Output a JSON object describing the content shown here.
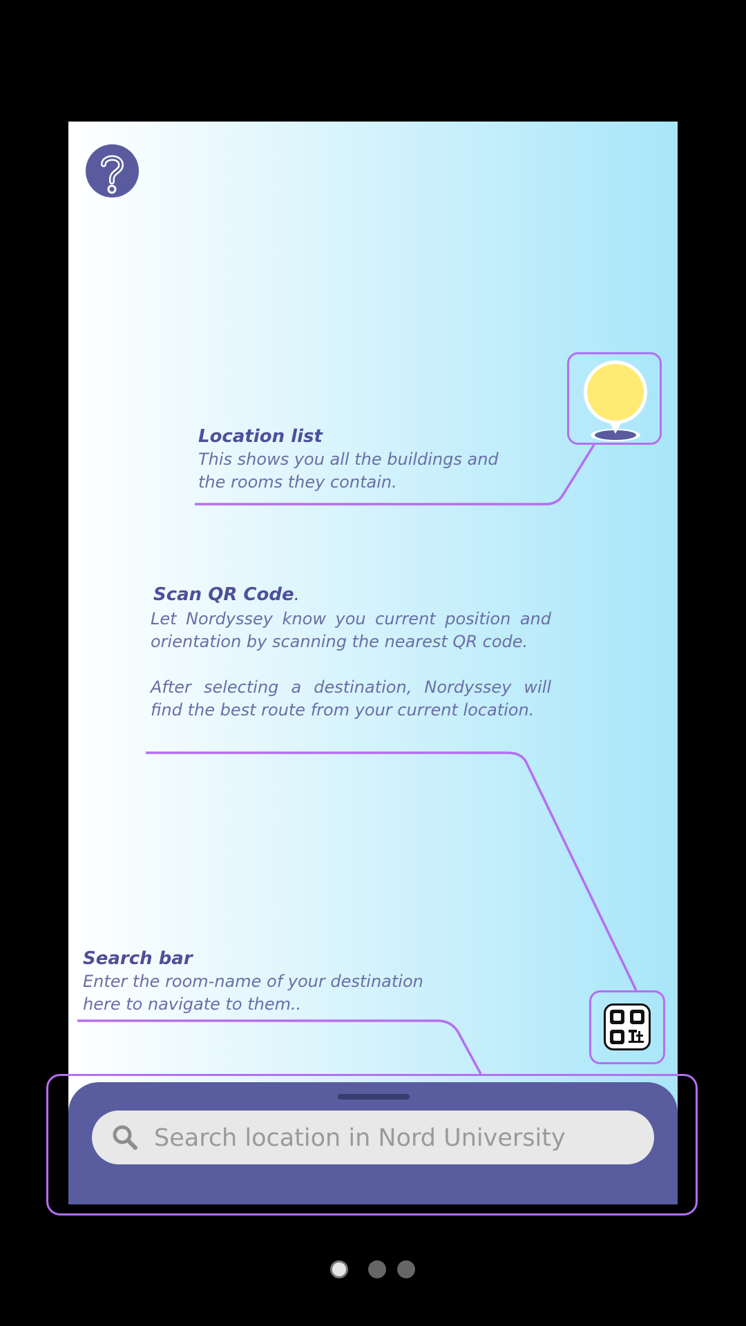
{
  "help": {
    "icon": "question-mark-icon"
  },
  "tips": {
    "location_list": {
      "title": "Location list",
      "body_line1": "This shows you all the buildings and",
      "body_line2": "the rooms they contain.",
      "icon": "map-pin-icon"
    },
    "scan_qr": {
      "title": "Scan QR Code",
      "title_suffix": ".",
      "body_para1": "Let Nordyssey know you current position and orientation by scanning the nearest QR code.",
      "body_para2": "After selecting a destination, Nordyssey will find the best route from your current location.",
      "icon": "qr-code-icon"
    },
    "search_bar": {
      "title": "Search bar",
      "body_line1": "Enter the room-name of your destination",
      "body_line2": "here to navigate to them.."
    }
  },
  "search": {
    "placeholder": "Search location in Nord University",
    "icon": "search-icon"
  },
  "pagination": {
    "count": 3,
    "active_index": 0
  },
  "colors": {
    "accent": "#5a5b9f",
    "highlight": "#b56ef2",
    "pin": "#ffeb73",
    "gradient_start": "#ffffff",
    "gradient_end": "#a8e6f9"
  }
}
